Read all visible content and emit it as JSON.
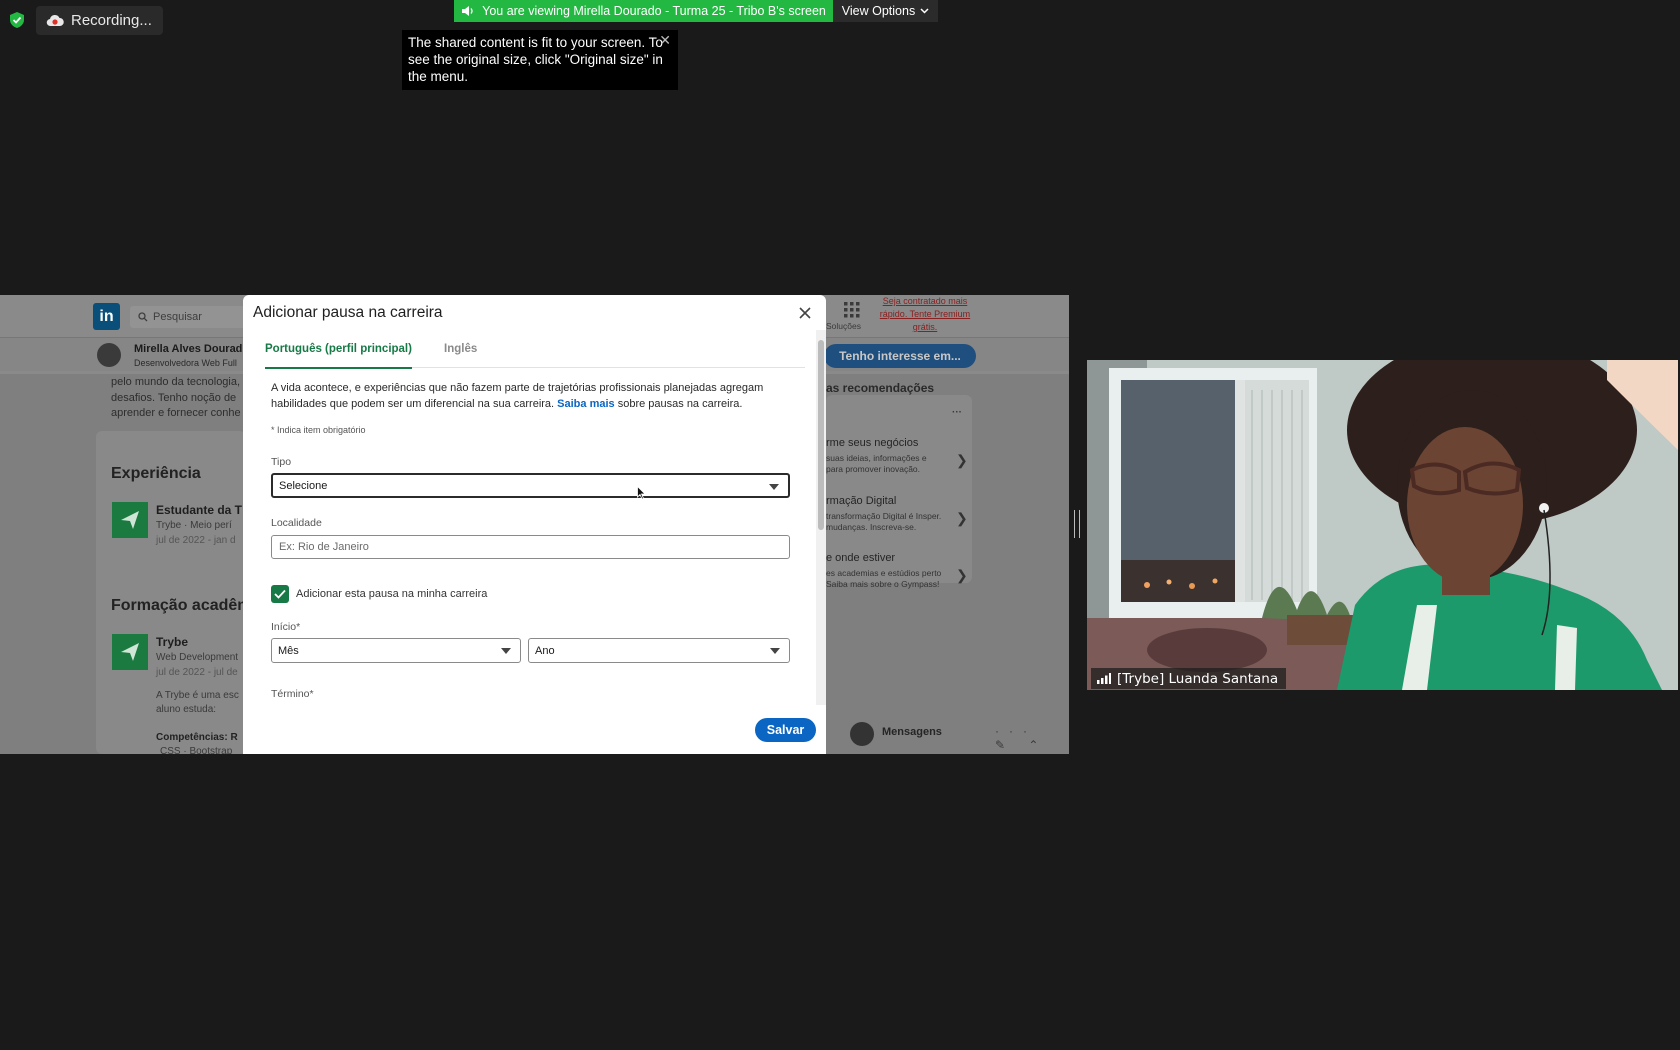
{
  "zoom": {
    "recording_label": "Recording...",
    "viewing_banner": "You are viewing Mirella Dourado - Turma 25 - Tribo B's screen",
    "view_options_label": "View Options",
    "tooltip_text": "The shared content is fit to your screen. To see the original size, click \"Original size\" in the menu.",
    "participant_name": "[Trybe] Luanda Santana",
    "colors": {
      "banner_green": "#23b842",
      "background": "#1a1a1a"
    }
  },
  "linkedin": {
    "search_placeholder": "Pesquisar",
    "profile_name": "Mirella Alves Dourad",
    "profile_headline": "Desenvolvedora Web Full",
    "premium_cta": "Seja contratado mais rápido. Tente Premium grátis.",
    "work_label": "Soluções",
    "interest_button": "Tenho interesse em...",
    "about_lines": [
      "pelo mundo da tecnologia,",
      "desafios. Tenho noção de",
      "aprender e fornecer conhe"
    ],
    "experience_heading": "Experiência",
    "experience_title": "Estudante da T",
    "experience_company": "Trybe · Meio perí",
    "experience_dates": "jul de 2022 - jan d",
    "education_heading": "Formação acadêm",
    "education_school": "Trybe",
    "education_course": "Web Development",
    "education_dates": "jul de 2022 - jul de",
    "education_desc": [
      "A Trybe é uma esc",
      "aluno estuda:"
    ],
    "education_skills": "Competências: R",
    "education_skills2": "CSS · Bootstrap",
    "recs_heading": "as recomendações",
    "recs": [
      {
        "title": "rme seus negócios",
        "sub": [
          "suas ideias, informações e",
          "para promover inovação."
        ]
      },
      {
        "title": "rmação Digital",
        "sub": [
          "transformação Digital é Insper.",
          "mudanças. Inscreva-se."
        ]
      },
      {
        "title": "e onde estiver",
        "sub": [
          "es academias e estúdios perto",
          "Saiba mais sobre o Gympass!"
        ]
      }
    ],
    "messages_label": "Mensagens",
    "more_label": "···"
  },
  "modal": {
    "title": "Adicionar pausa na carreira",
    "tabs": [
      {
        "label": "Português (perfil principal)",
        "active": true
      },
      {
        "label": "Inglês",
        "active": false
      }
    ],
    "intro_text": "A vida acontece, e experiências que não fazem parte de trajetórias profissionais planejadas agregam habilidades que podem ser um diferencial na sua carreira.",
    "intro_link": "Saiba mais",
    "intro_suffix": "sobre pausas na carreira.",
    "required_note": "* Indica item obrigatório",
    "type_label": "Tipo",
    "type_value": "Selecione",
    "location_label": "Localidade",
    "location_placeholder": "Ex: Rio de Janeiro",
    "checkbox_label": "Adicionar esta pausa na minha carreira",
    "checkbox_checked": true,
    "start_label": "Início*",
    "month_value": "Mês",
    "year_value": "Ano",
    "end_label": "Término*",
    "save_label": "Salvar",
    "colors": {
      "accent_green": "#177a46",
      "link_blue": "#0a66c2"
    }
  }
}
